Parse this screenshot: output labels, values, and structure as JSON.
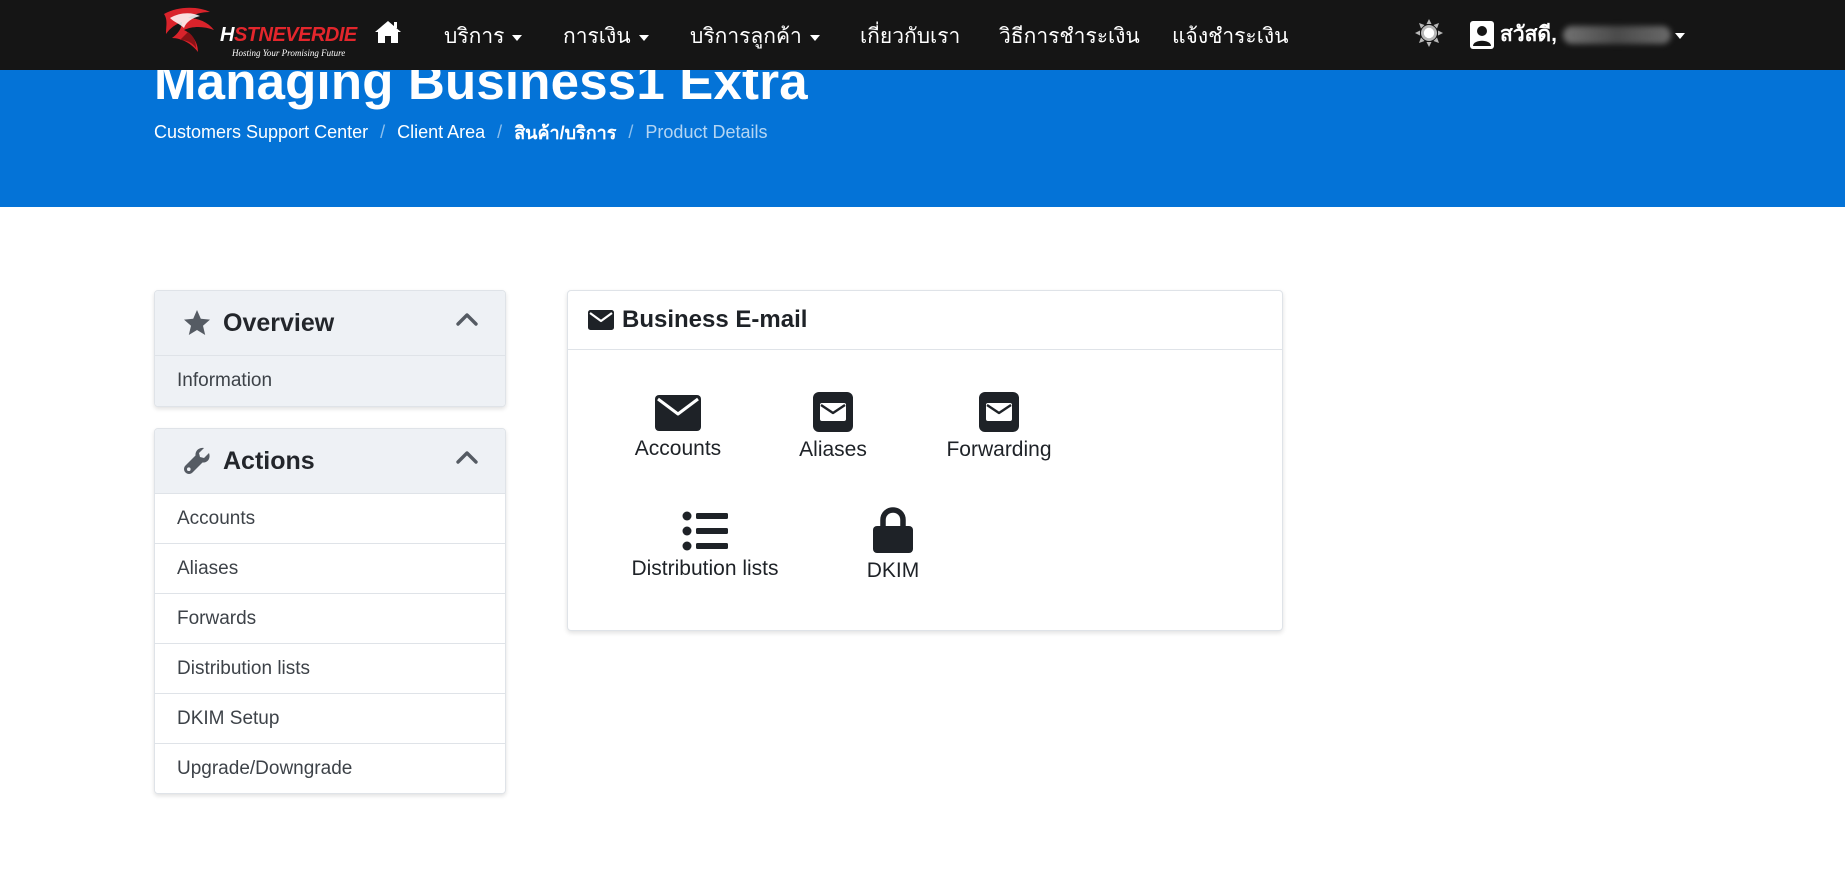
{
  "navbar": {
    "logo_text_1": "H",
    "logo_text_2": "STNEVERDIE",
    "logo_tagline": "Hosting Your Promising Future",
    "home_icon": "home-icon",
    "items": [
      {
        "label": "บริการ",
        "has_caret": true
      },
      {
        "label": "การเงิน",
        "has_caret": true
      },
      {
        "label": "บริการลูกค้า",
        "has_caret": true
      },
      {
        "label": "เกี่ยวกับเรา",
        "has_caret": false
      },
      {
        "label": "วิธีการชำระเงิน",
        "has_caret": false
      },
      {
        "label": "แจ้งชำระเงิน",
        "has_caret": false
      }
    ],
    "theme_icon": "sun-icon",
    "user_greeting": "สวัสดี,"
  },
  "hero": {
    "title": "Managing Business1 Extra",
    "breadcrumb": [
      {
        "label": "Customers Support Center"
      },
      {
        "label": "Client Area"
      },
      {
        "label": "สินค้า/บริการ"
      },
      {
        "label": "Product Details"
      }
    ],
    "background": "#0473d7"
  },
  "sidebar": {
    "overview": {
      "title": "Overview",
      "icon": "star-icon",
      "items": [
        {
          "label": "Information"
        }
      ]
    },
    "actions": {
      "title": "Actions",
      "icon": "wrench-icon",
      "items": [
        {
          "label": "Accounts"
        },
        {
          "label": "Aliases"
        },
        {
          "label": "Forwards"
        },
        {
          "label": "Distribution lists"
        },
        {
          "label": "DKIM Setup"
        },
        {
          "label": "Upgrade/Downgrade"
        }
      ]
    }
  },
  "main": {
    "card_title": "Business E-mail",
    "card_icon": "envelope-icon",
    "tiles": [
      {
        "label": "Accounts",
        "icon": "envelope-icon"
      },
      {
        "label": "Aliases",
        "icon": "envelope-square-icon"
      },
      {
        "label": "Forwarding",
        "icon": "envelope-square-icon"
      },
      {
        "label": "Distribution lists",
        "icon": "list-icon"
      },
      {
        "label": "DKIM",
        "icon": "lock-icon"
      }
    ]
  }
}
